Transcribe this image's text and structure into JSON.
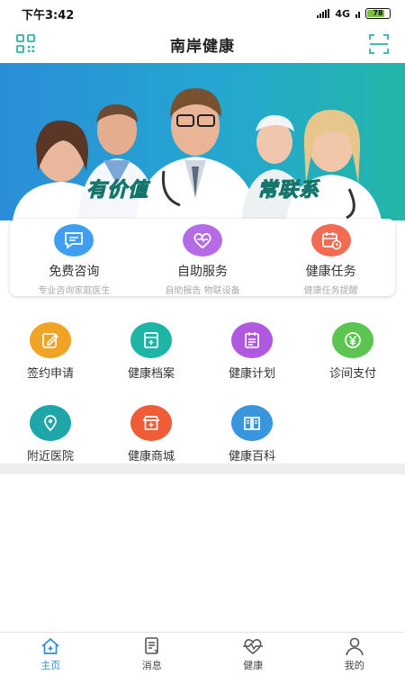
{
  "status_bar": {
    "time": "下午3:42",
    "network": "4G",
    "battery": "78"
  },
  "header": {
    "title": "南岸健康",
    "left_icon": "qr-code-icon",
    "right_icon": "scan-icon"
  },
  "banner": {
    "left_text": "有价值",
    "right_text": "常联系"
  },
  "services": [
    {
      "name": "免费咨询",
      "sub": "专业咨询家庭医生",
      "icon": "chat-icon",
      "color": "#3f9ef0"
    },
    {
      "name": "自助服务",
      "sub": "自助报告 物联设备",
      "icon": "heart-icon",
      "color": "#b56be6"
    },
    {
      "name": "健康任务",
      "sub": "健康任务提醒",
      "icon": "calendar-clock-icon",
      "color": "#f26b52"
    }
  ],
  "grid": [
    {
      "label": "签约申请",
      "icon": "edit-icon",
      "color": "#f0a325"
    },
    {
      "label": "健康档案",
      "icon": "archive-icon",
      "color": "#1fb5a6"
    },
    {
      "label": "健康计划",
      "icon": "plan-icon",
      "color": "#b058e0"
    },
    {
      "label": "诊间支付",
      "icon": "yen-icon",
      "color": "#5cc451"
    },
    {
      "label": "附近医院",
      "icon": "location-icon",
      "color": "#1ea6a8"
    },
    {
      "label": "健康商城",
      "icon": "store-icon",
      "color": "#ef5c37"
    },
    {
      "label": "健康百科",
      "icon": "book-icon",
      "color": "#3a95df"
    }
  ],
  "tabs": [
    {
      "label": "主页",
      "icon": "home-icon",
      "active": true
    },
    {
      "label": "消息",
      "icon": "message-icon",
      "active": false
    },
    {
      "label": "健康",
      "icon": "heart-pulse-icon",
      "active": false
    },
    {
      "label": "我的",
      "icon": "user-icon",
      "active": false
    }
  ],
  "colors": {
    "accent": "#2d8de0",
    "banner_start": "#2a8ed8",
    "banner_end": "#23b6a8"
  }
}
